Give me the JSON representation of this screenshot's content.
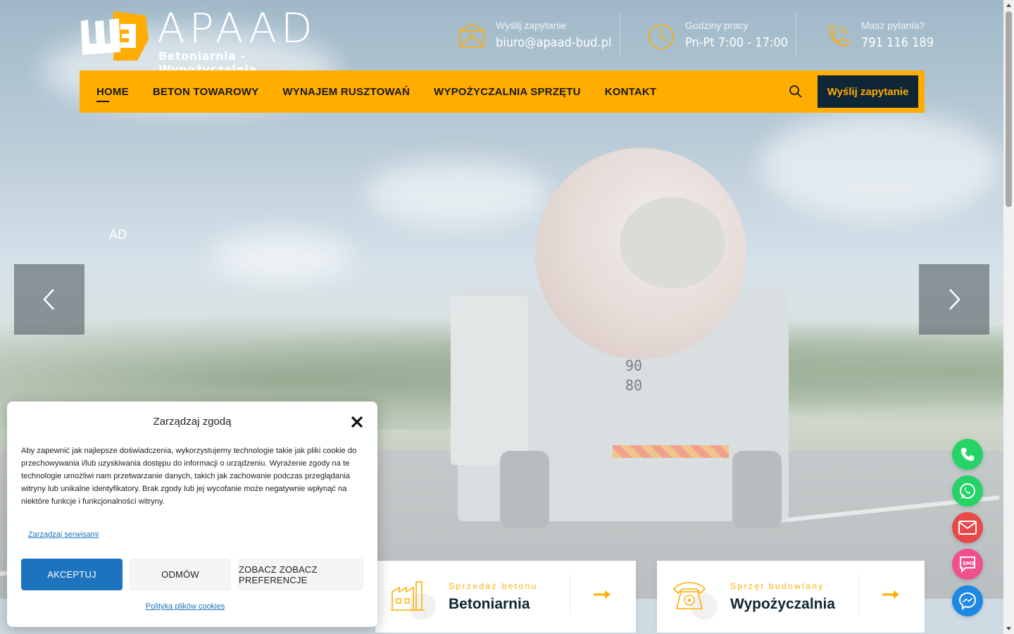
{
  "brand": {
    "name": "APAAD",
    "tagline": "Betoniarnia - Wypożyczalnia",
    "accent_color": "#ffad00",
    "dark_color": "#0e2636"
  },
  "header": {
    "email": {
      "label": "Wyślij zapytanie",
      "value": "biuro@apaad-bud.pl",
      "icon": "envelope-icon"
    },
    "hours": {
      "label": "Godziny pracy",
      "value": "Pn-Pt 7:00 - 17:00",
      "icon": "clock-icon"
    },
    "phone": {
      "label": "Masz pytania?",
      "value": "791 116 189",
      "icon": "phone-icon"
    }
  },
  "nav": {
    "items": [
      {
        "label": "HOME",
        "active": true
      },
      {
        "label": "BETON TOWAROWY"
      },
      {
        "label": "WYNAJEM RUSZTOWAŃ"
      },
      {
        "label": "WYPOŻYCZALNIA SPRZĘTU"
      },
      {
        "label": "KONTAKT"
      }
    ],
    "cta": "Wyślij zapytanie",
    "search_icon": "search-icon"
  },
  "hero": {
    "partial_text": "AD",
    "truck_plate": [
      "90",
      "80"
    ],
    "prev_icon": "chevron-left-icon",
    "next_icon": "chevron-right-icon"
  },
  "cards": [
    {
      "kicker": "Sprzedaż betonu",
      "title": "Betoniarnia",
      "icon": "factory-icon"
    },
    {
      "kicker": "Sprzęt budowlany",
      "title": "Wypożyczalnia",
      "icon": "telephone-icon"
    }
  ],
  "fabs": [
    {
      "name": "phone",
      "color": "#25d366"
    },
    {
      "name": "whatsapp",
      "color": "#25d366"
    },
    {
      "name": "email",
      "color": "#e84a4a"
    },
    {
      "name": "sms",
      "color": "#f0508e"
    },
    {
      "name": "messenger",
      "color": "#1e88e5"
    }
  ],
  "cookie": {
    "title": "Zarządzaj zgodą",
    "text": "Aby zapewnić jak najlepsze doświadczenia, wykorzystujemy technologie takie jak pliki cookie do przechowywania i/lub uzyskiwania dostępu do informacji o urządzeniu. Wyrażenie zgody na te technologie umożliwi nam przetwarzanie danych, takich jak zachowanie podczas przeglądania witryny lub unikalne identyfikatory. Brak zgody lub jej wycofanie może negatywnie wpłynąć na niektóre funkcje i funkcjonalności witryny.",
    "manage_link": "Zarządzaj serwisami",
    "accept": "AKCEPTUJ",
    "deny": "ODMÓW",
    "preferences": "ZOBACZ ZOBACZ PREFERENCJE",
    "policy_link": "Polityka plików cookies"
  }
}
